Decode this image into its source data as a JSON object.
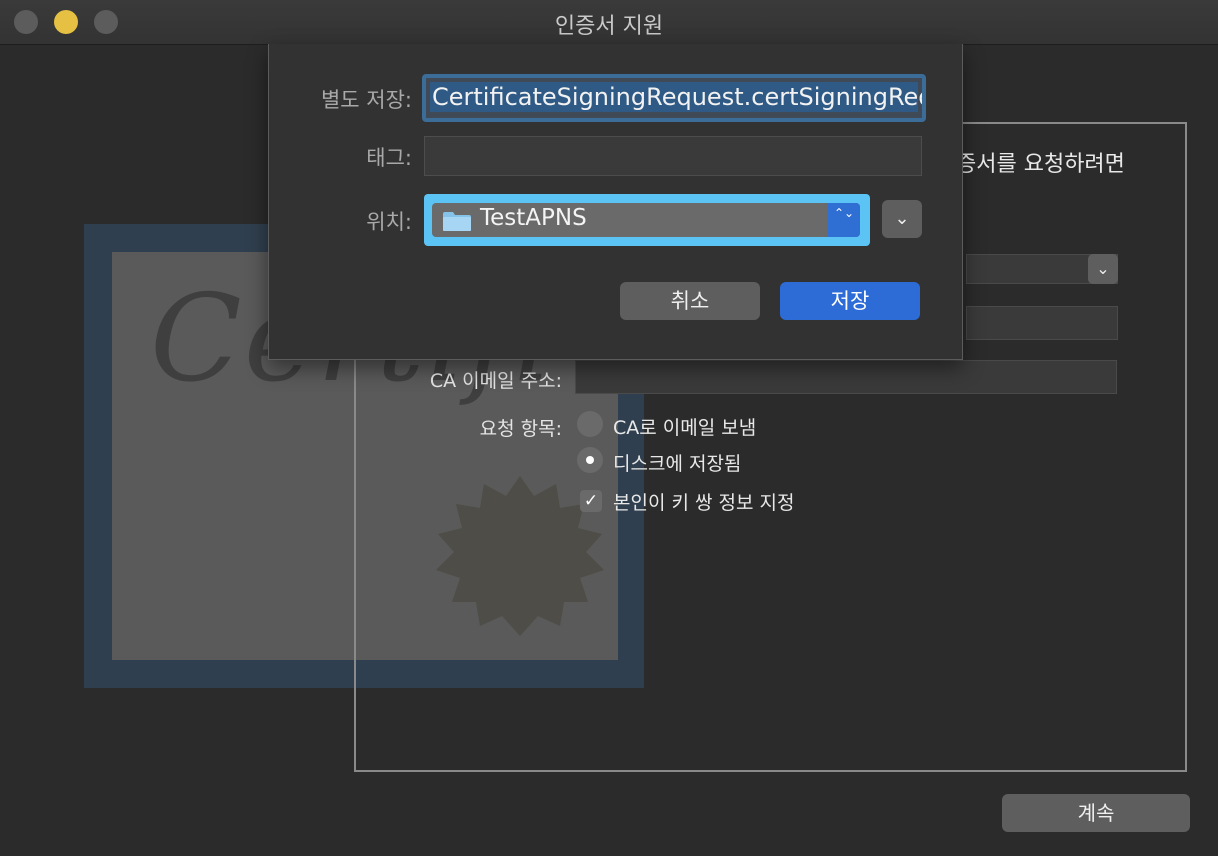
{
  "window": {
    "title": "인증서 지원"
  },
  "main": {
    "intro_text": "증서를 요청하려면",
    "ca_email_label": "CA 이메일 주소:",
    "request_label": "요청 항목:",
    "options": [
      {
        "label": "CA로 이메일 보냄",
        "selected": false
      },
      {
        "label": "디스크에 저장됨",
        "selected": true
      }
    ],
    "keypair_label": "본인이 키 쌍 정보 지정",
    "keypair_checked": true,
    "continue_label": "계속",
    "chevron_glyph": "⌄"
  },
  "certificate_art": {
    "script_text": "Certifi"
  },
  "save_sheet": {
    "save_as_label": "별도 저장:",
    "save_as_value": "CertificateSigningRequest.certSigningRequest",
    "tags_label": "태그:",
    "location_label": "위치:",
    "location_value": "TestAPNS",
    "cancel_label": "취소",
    "save_label": "저장"
  },
  "icons": {
    "stepper": "⌃⌄",
    "expand": "⌄"
  },
  "colors": {
    "accent": "#2d6bd6",
    "focus_ring": "#5cc4f4",
    "minimize": "#e6c042"
  }
}
